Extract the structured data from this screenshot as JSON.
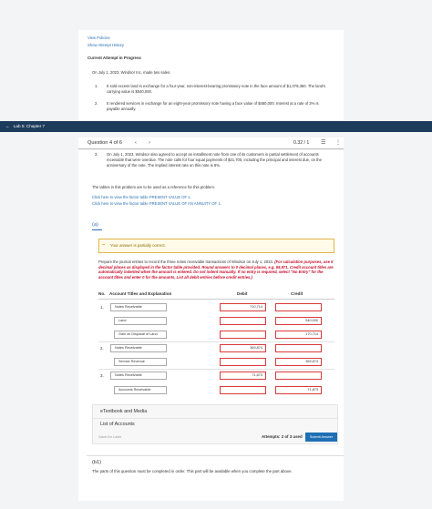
{
  "top_links": {
    "view_policies": "View Policies",
    "show_attempt_history": "Show Attempt History"
  },
  "current_attempt": "Current Attempt in Progress",
  "intro": "On July 1, 2023, Windsor Inc. made two sales.",
  "problems": [
    {
      "num": "1.",
      "text": "It sold excess land in exchange for a four-year, non-interest-bearing promissory note in the face amount of $1,079,350. The land's carrying value is $540,000."
    },
    {
      "num": "2.",
      "text": "It rendered services in exchange for an eight-year promissory note having a face value of $460,000. Interest at a rate of 3% is payable annually."
    }
  ],
  "lab_bar": {
    "arrow": "←",
    "label": "Lab 5: Chapter 7"
  },
  "question": {
    "title": "Question 4 of 6",
    "prev": "‹",
    "next": "›",
    "score": "0.32 / 1",
    "list_icon": "☰",
    "more_icon": "⋮"
  },
  "problem3": {
    "num": "3.",
    "text": "On July 1, 2023, Windsor also agreed to accept an installment note from one of its customers in partial settlement of accounts receivable that were overdue. The note calls for four equal payments of $21,705, including the principal and interest due, on the anniversary of the note. The implied interest rate on this note is 8%."
  },
  "tables_note": "The tables in this problem are to be used as a reference for this problem.",
  "factor_links": [
    "Click here to view the factor table PRESENT VALUE OF 1.",
    "Click here to view the factor table PRESENT VALUE OF AN ANNUITY OF 1."
  ],
  "part_a": "(a)",
  "partial_banner": {
    "dash": "–",
    "text": "Your answer is partially correct."
  },
  "instructions": {
    "normal": "Prepare the journal entries to record the three notes receivable transactions of Windsor on July 1, 2023.",
    "emphasis": "(For calculation purposes, use 5 decimal places as displayed in the factor table provided. Round answers to 0 decimal places, e.g. 58,971. Credit account titles are automatically indented when the amount is entered. Do not indent manually. If no entry is required, select \"No Entry\" for the account titles and enter 0 for the amounts. List all debit entries before credit entries.)"
  },
  "table": {
    "headers": {
      "no": "No.",
      "account": "Account Titles and Explanation",
      "debit": "Debit",
      "credit": "Credit"
    },
    "entries": [
      {
        "num": "1.",
        "lines": [
          {
            "account": "Notes Receivable",
            "debit": "710,714",
            "credit": ""
          },
          {
            "account": "Land",
            "debit": "",
            "credit": "540,000"
          },
          {
            "account": "Gain on Disposal of Land",
            "debit": "",
            "credit": "170,714"
          }
        ]
      },
      {
        "num": "2.",
        "lines": [
          {
            "account": "Notes Receivable",
            "debit": "369,874",
            "credit": ""
          },
          {
            "account": "Service Revenue",
            "debit": "",
            "credit": "369,874"
          }
        ]
      },
      {
        "num": "3.",
        "lines": [
          {
            "account": "Notes Receivable",
            "debit": "71,873",
            "credit": ""
          },
          {
            "account": "Accounts Receivable",
            "debit": "",
            "credit": "71,873"
          }
        ]
      }
    ]
  },
  "etextbook": "eTextbook and Media",
  "list_of_accounts": "List of Accounts",
  "save_for_later": "Save for Later",
  "attempts": "Attempts: 2 of 3 used",
  "submit": "Submit Answer",
  "part_b1": "(b1)",
  "part_b1_text": "The parts of this question must be completed in order. This part will be available when you complete the part above."
}
